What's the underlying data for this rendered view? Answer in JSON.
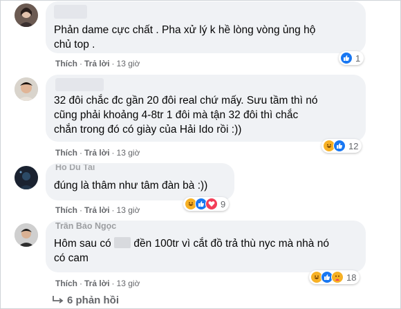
{
  "comments": [
    {
      "text_lines": [
        "Phản dame cực chất . Pha xử lý k hề lòng vòng ủng hộ",
        "chủ top ."
      ],
      "actions": {
        "like": "Thích",
        "reply": "Trả lời",
        "time": "13 giờ"
      },
      "reaction_count": "1"
    },
    {
      "text_lines": [
        "32 đôi chắc đc gần 20 đôi real chứ mấy. Sưu tầm thì nó",
        "cũng phải khoảng 4-8tr 1 đôi mà tận 32 đôi thì chắc",
        "chắn trong đó có giày của Hải Ido rồi :))"
      ],
      "actions": {
        "like": "Thích",
        "reply": "Trả lời",
        "time": "13 giờ"
      },
      "reaction_count": "12"
    },
    {
      "name": "Ho Du Tai",
      "text_lines": [
        "đúng là thâm như tâm đàn bà :))"
      ],
      "actions": {
        "like": "Thích",
        "reply": "Trả lời",
        "time": "13 giờ"
      },
      "reaction_count": "9"
    },
    {
      "name": "Trần Bảo Ngọc",
      "text_line1_a": "Hôm sau có",
      "text_line1_b": "đền 100tr vì cắt đồ trả thù nyc mà nhà nó",
      "text_line2": "có cam",
      "actions": {
        "like": "Thích",
        "reply": "Trả lời",
        "time": "13 giờ"
      },
      "reaction_count": "18"
    }
  ],
  "replies_label": "6 phản hồi",
  "colors": {
    "bubble": "#f0f2f5",
    "meta": "#65676b",
    "like": "#1877f2",
    "haha": "#f7b125",
    "love": "#f33e58"
  }
}
